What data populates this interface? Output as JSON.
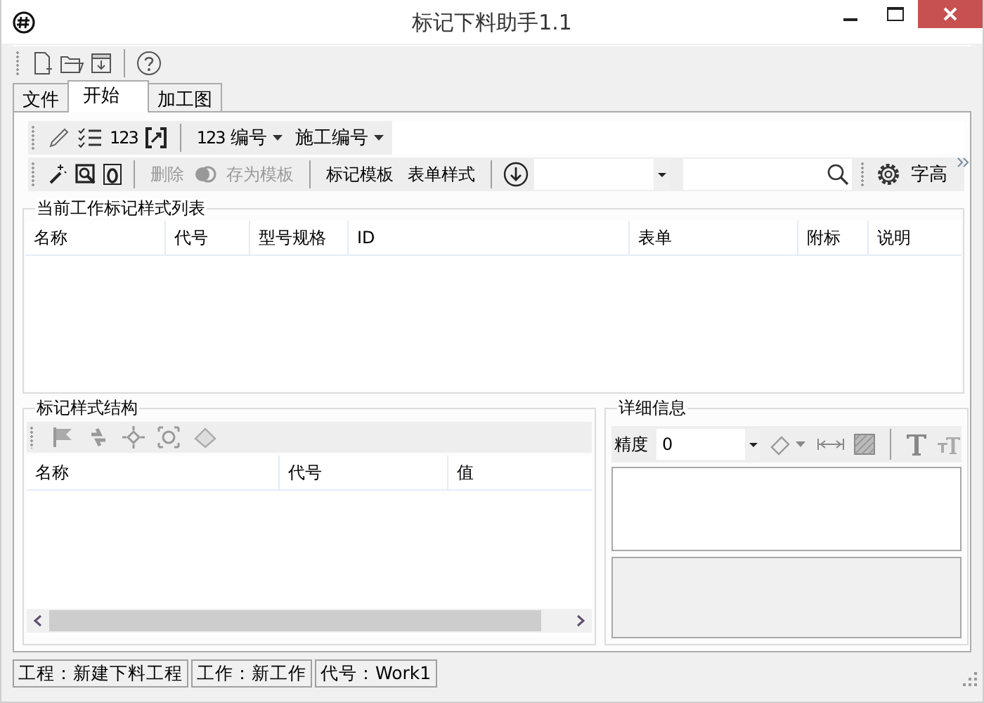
{
  "window": {
    "title": "标记下料助手1.1"
  },
  "tabs": [
    {
      "label": "文件",
      "selected": false
    },
    {
      "label": "开始",
      "selected": true
    },
    {
      "label": "加工图",
      "selected": false
    }
  ],
  "ribbon": {
    "number_tool": "123",
    "numbering": {
      "icon_text": "123",
      "label": "编号"
    },
    "construction_numbering": {
      "label": "施工编号"
    },
    "buttons": [
      {
        "label": "删除",
        "disabled": true
      },
      {
        "label": "存为模板",
        "disabled": true
      },
      {
        "label": "标记模板",
        "disabled": false
      },
      {
        "label": "表单样式",
        "disabled": false
      }
    ],
    "font_height_button": "字高"
  },
  "mark_style_list": {
    "title": "当前工作标记样式列表",
    "columns": [
      "名称",
      "代号",
      "型号规格",
      "ID",
      "表单",
      "附标",
      "说明"
    ]
  },
  "mark_style_structure": {
    "title": "标记样式结构",
    "columns": [
      "名称",
      "代号",
      "值"
    ]
  },
  "details": {
    "title": "详细信息",
    "precision": {
      "label": "精度",
      "value": "0"
    }
  },
  "status_bar": [
    "工程：新建下料工程",
    "工作：新工作",
    "代号：Work1"
  ]
}
